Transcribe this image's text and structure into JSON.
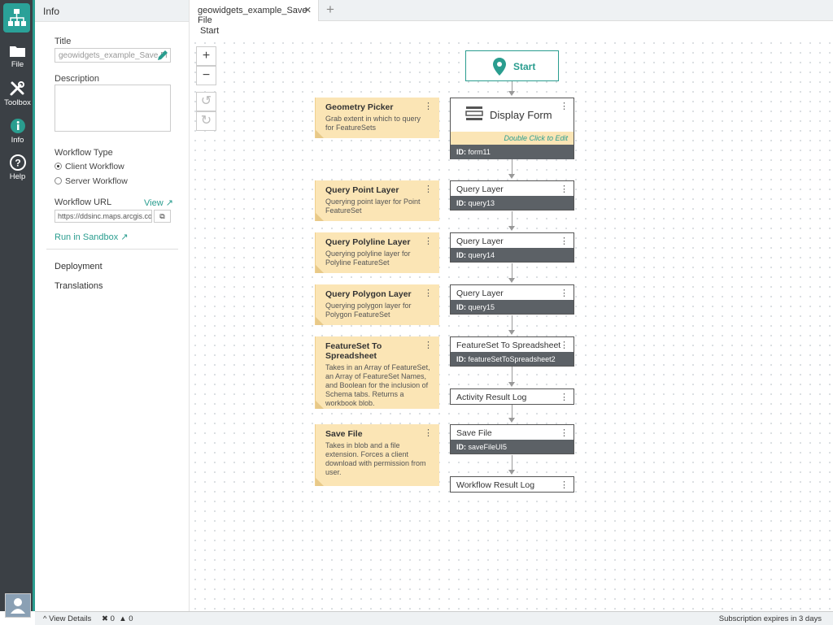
{
  "rail": {
    "items": [
      {
        "label": "File",
        "icon": "folder-icon"
      },
      {
        "label": "Toolbox",
        "icon": "tools-icon"
      },
      {
        "label": "Info",
        "icon": "info-icon"
      },
      {
        "label": "Help",
        "icon": "help-icon"
      }
    ]
  },
  "info": {
    "header": "Info",
    "title_label": "Title",
    "title_value": "geowidgets_example_Save Fi",
    "description_label": "Description",
    "workflow_type_label": "Workflow Type",
    "client_workflow": "Client Workflow",
    "server_workflow": "Server Workflow",
    "workflow_url_label": "Workflow URL",
    "view_link": "View",
    "url_value": "https://ddsinc.maps.arcgis.con",
    "run_sandbox": "Run in Sandbox",
    "deployment": "Deployment",
    "translations": "Translations"
  },
  "tabs": {
    "active": "geowidgets_example_Save File",
    "close": "✕",
    "add": "+"
  },
  "breadcrumb": "Start",
  "zoom": {
    "plus": "+",
    "minus": "−",
    "undo": "↺",
    "redo": "↻"
  },
  "start_label": "Start",
  "form": {
    "title": "Display Form",
    "hint": "Double Click to Edit",
    "id_label": "ID:",
    "id_value": "form11"
  },
  "nodes": [
    {
      "title": "Query Layer",
      "id": "query13"
    },
    {
      "title": "Query Layer",
      "id": "query14"
    },
    {
      "title": "Query Layer",
      "id": "query15"
    },
    {
      "title": "FeatureSet To Spreadsheet",
      "id": "featureSetToSpreadsheet2"
    },
    {
      "title": "Activity Result Log",
      "id": ""
    },
    {
      "title": "Save File",
      "id": "saveFileUI5"
    },
    {
      "title": "Workflow Result Log",
      "id": ""
    }
  ],
  "notes": [
    {
      "title": "Geometry Picker",
      "desc": "Grab extent in which to query for FeatureSets"
    },
    {
      "title": "Query Point Layer",
      "desc": "Querying point layer for Point FeatureSet"
    },
    {
      "title": "Query Polyline Layer",
      "desc": "Querying polyline layer for Polyline FeatureSet"
    },
    {
      "title": "Query Polygon Layer",
      "desc": "Querying polygon layer for Polygon FeatureSet"
    },
    {
      "title": "FeatureSet To Spreadsheet",
      "desc": "Takes in an Array of FeatureSet, an Array of FeatureSet Names, and Boolean for the inclusion of Schema tabs. Returns a workbook blob."
    },
    {
      "title": "Save File",
      "desc": "Takes in blob and a file extension. Forces a client download with permission from user."
    }
  ],
  "status": {
    "view_details": "View Details",
    "errors": "0",
    "warnings": "0",
    "subscription": "Subscription expires in 3 days"
  },
  "colors": {
    "accent": "#2a9d8f",
    "note": "#fbe5b5",
    "rail": "#3b4045"
  }
}
